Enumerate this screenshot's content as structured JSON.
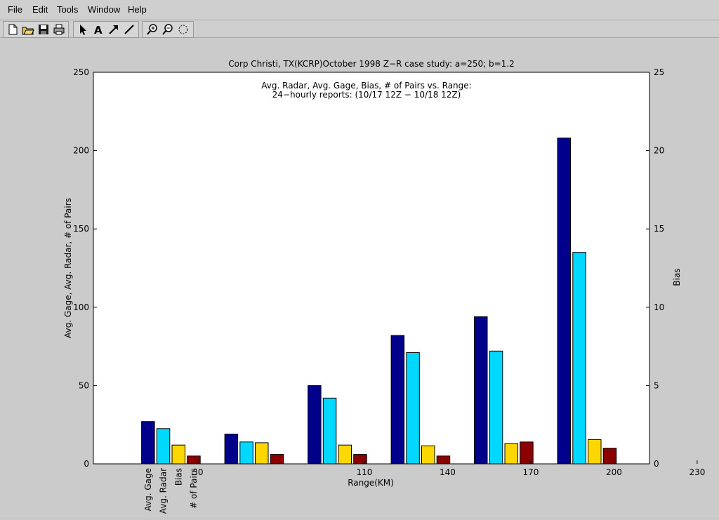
{
  "menu": {
    "file": "File",
    "edit": "Edit",
    "tools": "Tools",
    "window": "Window",
    "help": "Help"
  },
  "toolbar": {
    "icons": [
      "new-file-icon",
      "open-folder-icon",
      "save-icon",
      "print-icon",
      "pointer-arrow-icon",
      "text-icon",
      "arrow-icon",
      "line-icon",
      "zoom-in-icon",
      "zoom-out-icon",
      "rotate-icon"
    ]
  },
  "chart_data": {
    "type": "bar",
    "title": "Corp Christi, TX(KCRP)October 1998 Z−R case study: a=250; b=1.2",
    "subtitle_line1": "Avg. Radar, Avg. Gage, Bias, # of Pairs vs. Range:",
    "subtitle_line2": "24−hourly reports: (10/17 12Z − 10/18 12Z)",
    "xlabel": "Range(KM)",
    "ylabel": "Avg. Gage, Avg. Radar, # of Pairs",
    "y2label": "Bias",
    "xlim": [
      20,
      260
    ],
    "ylim": [
      0,
      250
    ],
    "y2lim": [
      0,
      25
    ],
    "xticks": [
      50,
      110,
      140,
      170,
      200,
      230
    ],
    "yticks": [
      0,
      50,
      100,
      150,
      200,
      250
    ],
    "y2ticks": [
      0,
      5,
      10,
      15,
      20,
      25
    ],
    "legend_labels": [
      "Avg. Gage",
      "Avg. Radar",
      "Bias",
      "# of Pairs"
    ],
    "groups": [
      {
        "series": "Avg. Gage",
        "color": "#00008b",
        "bars": [
          {
            "x": 32,
            "value": 27
          },
          {
            "x": 62,
            "value": 19
          },
          {
            "x": 92,
            "value": 50
          },
          {
            "x": 122,
            "value": 82
          },
          {
            "x": 152,
            "value": 94
          },
          {
            "x": 182,
            "value": 208
          }
        ]
      },
      {
        "series": "Avg. Radar",
        "color": "#00d8ff",
        "bars": [
          {
            "x": 37.5,
            "value": 22.5
          },
          {
            "x": 67.5,
            "value": 14
          },
          {
            "x": 97.5,
            "value": 42
          },
          {
            "x": 127.5,
            "value": 71
          },
          {
            "x": 157.5,
            "value": 72
          },
          {
            "x": 187.5,
            "value": 135
          }
        ]
      },
      {
        "series": "Bias",
        "color": "#ffd700",
        "bars": [
          {
            "x": 43,
            "value": 1.2
          },
          {
            "x": 73,
            "value": 1.35
          },
          {
            "x": 103,
            "value": 1.2
          },
          {
            "x": 133,
            "value": 1.15
          },
          {
            "x": 163,
            "value": 1.3
          },
          {
            "x": 193,
            "value": 1.55
          }
        ]
      },
      {
        "series": "# of Pairs",
        "color": "#8b0000",
        "bars": [
          {
            "x": 48.5,
            "value": 5
          },
          {
            "x": 78.5,
            "value": 6
          },
          {
            "x": 108.5,
            "value": 6
          },
          {
            "x": 138.5,
            "value": 5
          },
          {
            "x": 168.5,
            "value": 14
          },
          {
            "x": 198.5,
            "value": 10
          }
        ]
      }
    ]
  }
}
